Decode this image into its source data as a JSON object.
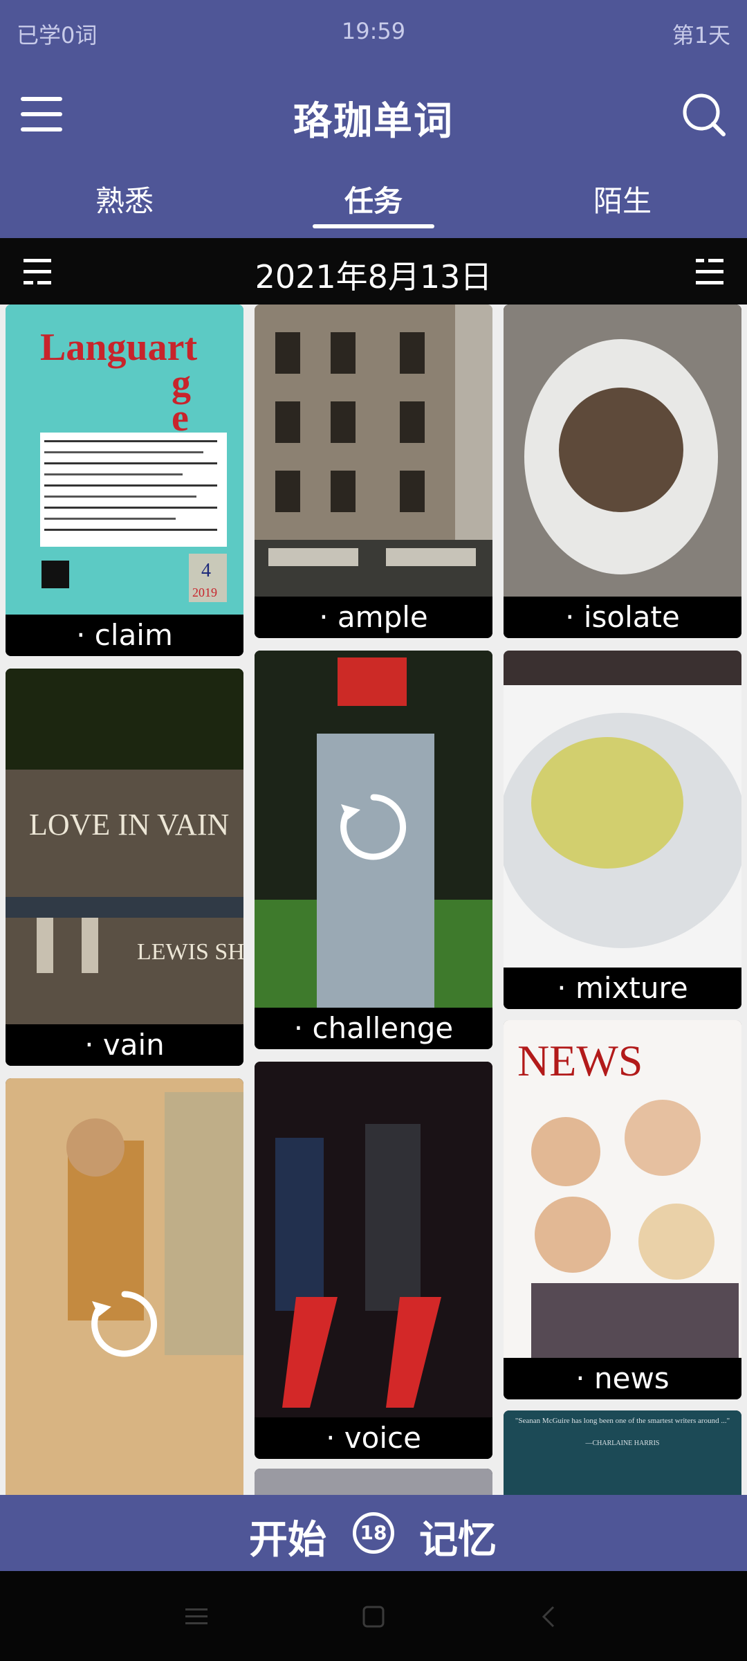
{
  "status_bar": {
    "left": "已学0词",
    "time": "19:59",
    "right": "第1天"
  },
  "header": {
    "title": "珞珈单词",
    "menu_icon": "hamburger-menu-icon",
    "search_icon": "search-icon"
  },
  "tabs": [
    {
      "label": "熟悉"
    },
    {
      "label": "任务",
      "active": true
    },
    {
      "label": "陌生"
    }
  ],
  "date_bar": {
    "date": "2021年8月13日",
    "left_icon": "list-icon",
    "right_icon": "list-icon"
  },
  "cards": [
    {
      "word": "· claim"
    },
    {
      "word": "· ample"
    },
    {
      "word": "· isolate"
    },
    {
      "word": "· vain"
    },
    {
      "word": "· challenge",
      "icon": "refresh-icon"
    },
    {
      "word": "· mixture"
    },
    {
      "word": "·",
      "icon": "refresh-icon"
    },
    {
      "word": "· voice"
    },
    {
      "word": "· news"
    }
  ],
  "cover_text": {
    "languart_title": "Languart",
    "languart_vol": "4",
    "languart_year": "2019",
    "love_in_vain": "LOVE IN VAIN",
    "lewis_shiner": "LEWIS SHINER",
    "news_title": "NEWS",
    "book_quote": "\"Seanan McGuire has long been one of the smartest writers around ...\"",
    "book_author": "—CHARLAINE HARRIS"
  },
  "bottom_bar": {
    "start_label": "开始",
    "count": "18",
    "remember_label": "记忆"
  },
  "colors": {
    "primary": "#4f5697",
    "dark_bar": "#0a0a0a",
    "background": "#eeeeee"
  }
}
